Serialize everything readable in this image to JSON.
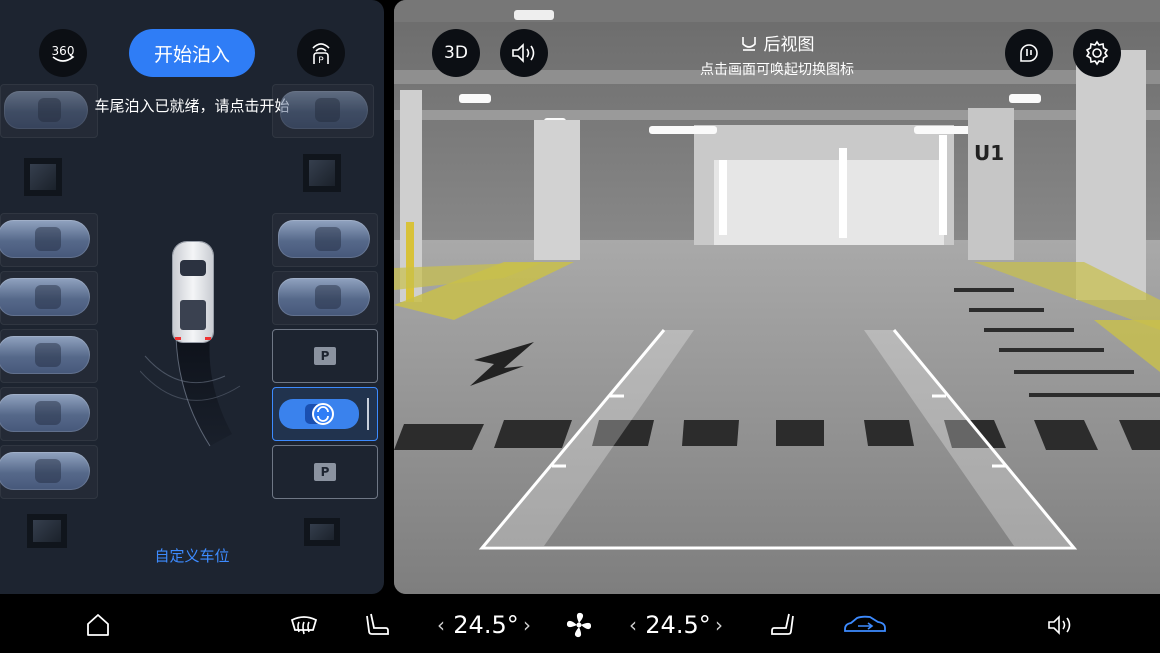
{
  "left_panel": {
    "btn_360_label": "360",
    "start_button_label": "开始泊入",
    "status_text": "车尾泊入已就绪，请点击开始",
    "custom_slot_label": "自定义车位",
    "parking_mark": "P"
  },
  "camera": {
    "btn_3d_label": "3D",
    "view_title": "后视图",
    "view_subtitle": "点击画面可唤起切换图标",
    "pillar_sign": "U1"
  },
  "bottom_bar": {
    "left_temp": "24.5°",
    "right_temp": "24.5°",
    "chev_left": "‹",
    "chev_right": "›"
  },
  "colors": {
    "accent": "#2f7df6",
    "panel_bg": "#1d2430",
    "active_car": "#3d8bff"
  },
  "icons": [
    "360-view-icon",
    "auto-park-icon",
    "sound-icon",
    "voice-assistant-icon",
    "settings-icon",
    "home-icon",
    "defrost-icon",
    "seat-heat-icon",
    "fan-icon",
    "seat-vent-icon",
    "car-mode-icon",
    "volume-icon",
    "rear-camera-icon"
  ]
}
